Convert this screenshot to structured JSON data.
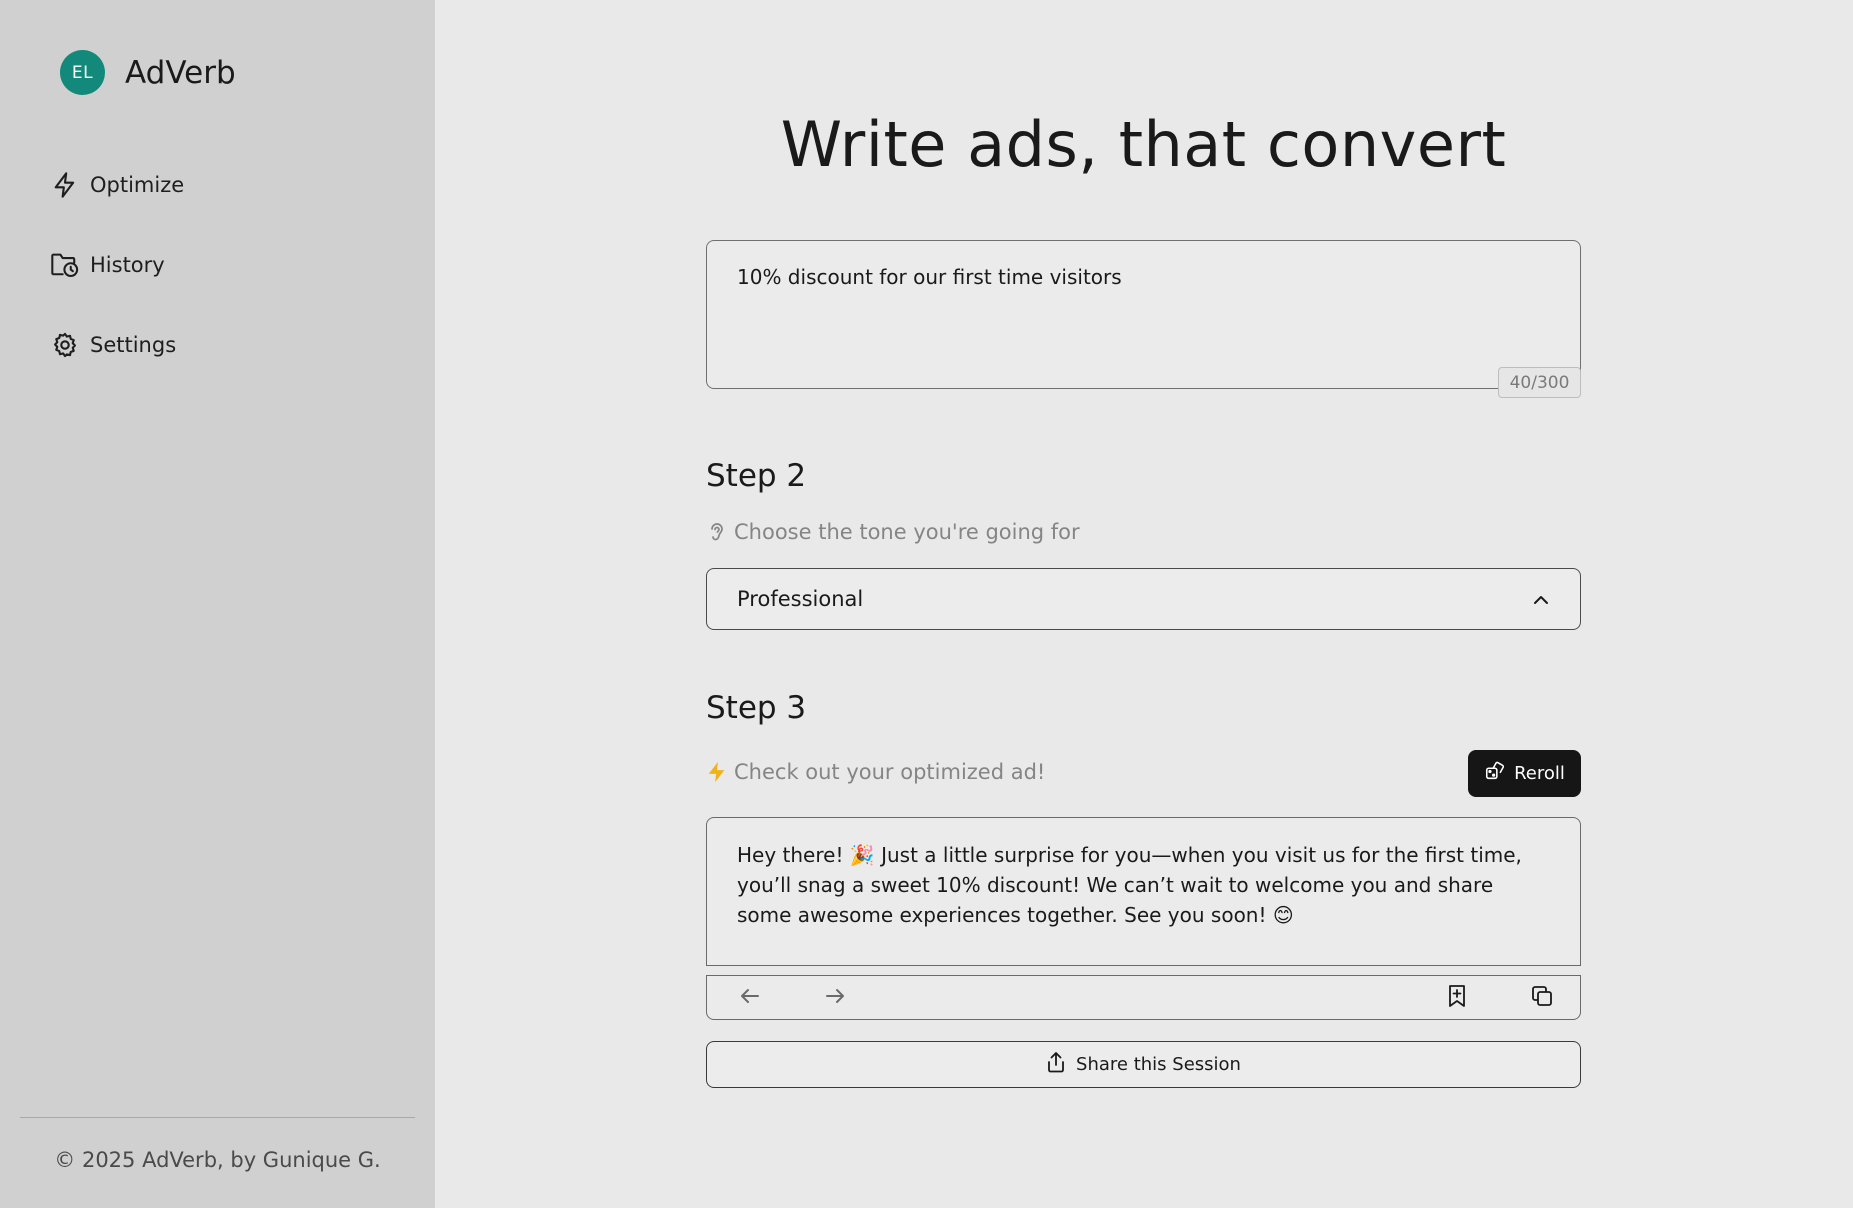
{
  "sidebar": {
    "avatar_initials": "EL",
    "brand_name": "AdVerb",
    "nav": [
      {
        "label": "Optimize",
        "icon": "lightning-icon"
      },
      {
        "label": "History",
        "icon": "folder-clock-icon"
      },
      {
        "label": "Settings",
        "icon": "gear-icon"
      }
    ],
    "footer": "© 2025 AdVerb, by Gunique G."
  },
  "main": {
    "title": "Write ads, that convert",
    "prompt": {
      "value": "10% discount for our first time visitors",
      "char_count": "40/300"
    },
    "step2": {
      "heading": "Step 2",
      "subtitle": "Choose the tone you're going for",
      "subtitle_icon": "ear-icon",
      "selected_tone": "Professional"
    },
    "step3": {
      "heading": "Step 3",
      "subtitle": "Check out your optimized ad!",
      "subtitle_icon": "lightning-icon",
      "reroll_label": "Reroll",
      "output": "Hey there! 🎉 Just a little surprise for you—when you visit us for the first time, you’ll snag a sweet 10% discount! We can’t wait to welcome you and share some awesome experiences together. See you soon! 😊"
    },
    "share_label": "Share this Session"
  },
  "colors": {
    "sidebar_bg": "#d0d0d0",
    "main_bg": "#e9e9e9",
    "avatar_bg": "#12897a",
    "accent_bolt": "#f0b21a",
    "button_dark": "#161616"
  }
}
